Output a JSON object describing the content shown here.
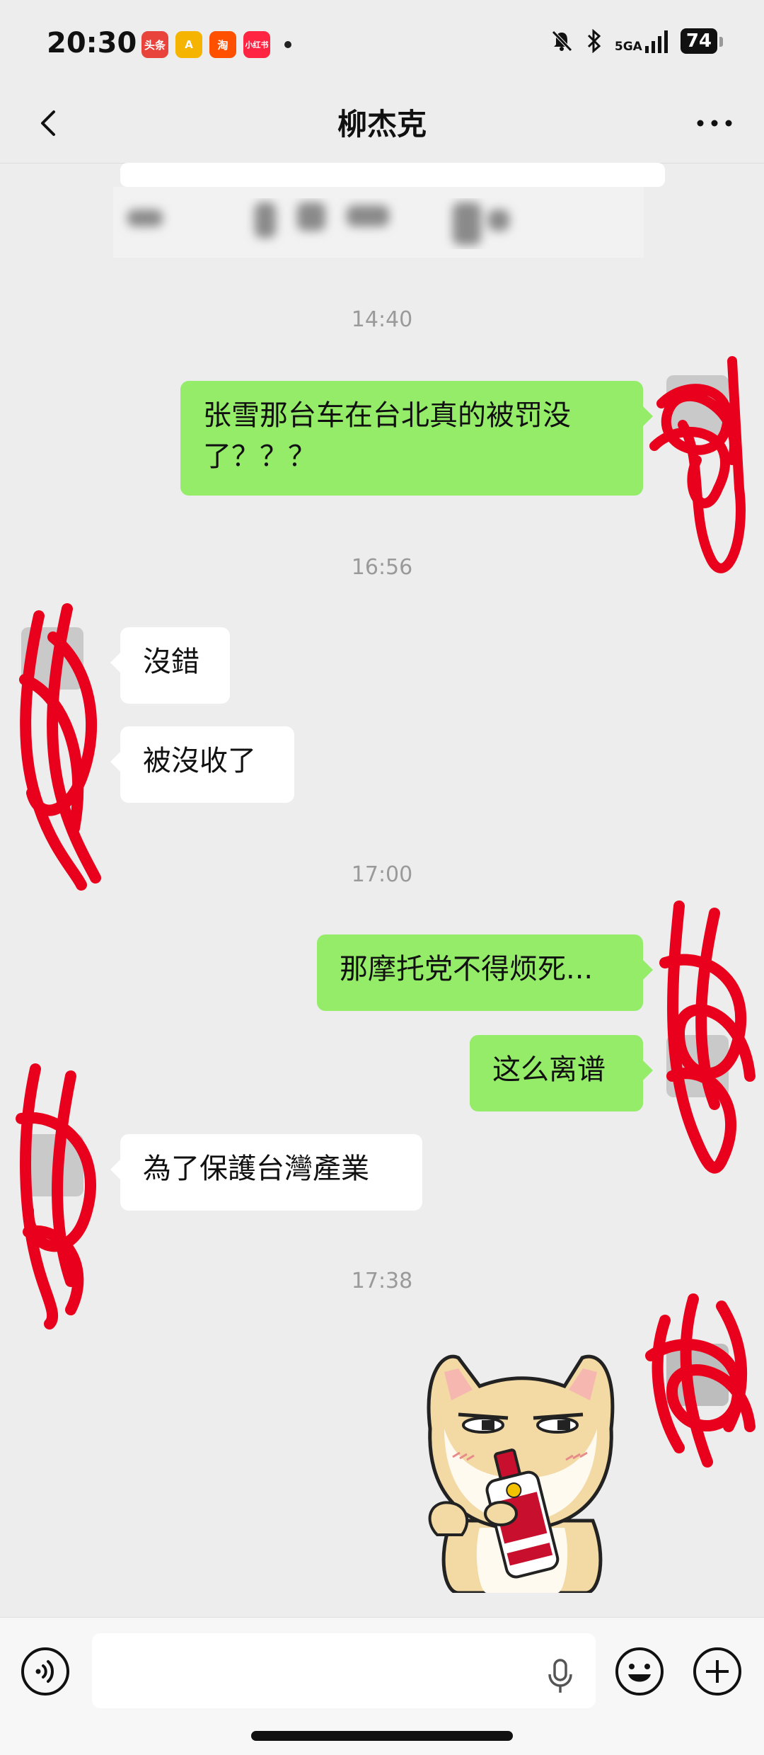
{
  "status_bar": {
    "time": "20:30",
    "app_icons": [
      {
        "name": "toutiao",
        "label": "头条",
        "color": "#e8443b"
      },
      {
        "name": "amap",
        "label": "A",
        "color": "#f5b400"
      },
      {
        "name": "taobao",
        "label": "淘",
        "color": "#ff5000"
      },
      {
        "name": "xiaohongshu",
        "label": "小红书",
        "color": "#ff2442"
      }
    ],
    "network": "5GA",
    "battery": "74"
  },
  "header": {
    "title": "柳杰克"
  },
  "messages": [
    {
      "type": "time",
      "text": "14:40"
    },
    {
      "type": "me",
      "text": "张雪那台车在台北真的被罚没了？？？"
    },
    {
      "type": "time",
      "text": "16:56"
    },
    {
      "type": "other",
      "text": "沒錯"
    },
    {
      "type": "other",
      "text": "被沒收了"
    },
    {
      "type": "time",
      "text": "17:00"
    },
    {
      "type": "me",
      "text": "那摩托党不得烦死..."
    },
    {
      "type": "me",
      "text": "这么离谱"
    },
    {
      "type": "other",
      "text": "為了保護台灣產業"
    },
    {
      "type": "time",
      "text": "17:38"
    },
    {
      "type": "me_sticker",
      "text": "",
      "sticker_label": "茅台"
    }
  ],
  "colors": {
    "background": "#ededed",
    "my_bubble": "#95ec69",
    "other_bubble": "#ffffff",
    "redaction": "#e8001c"
  },
  "input": {
    "value": ""
  }
}
